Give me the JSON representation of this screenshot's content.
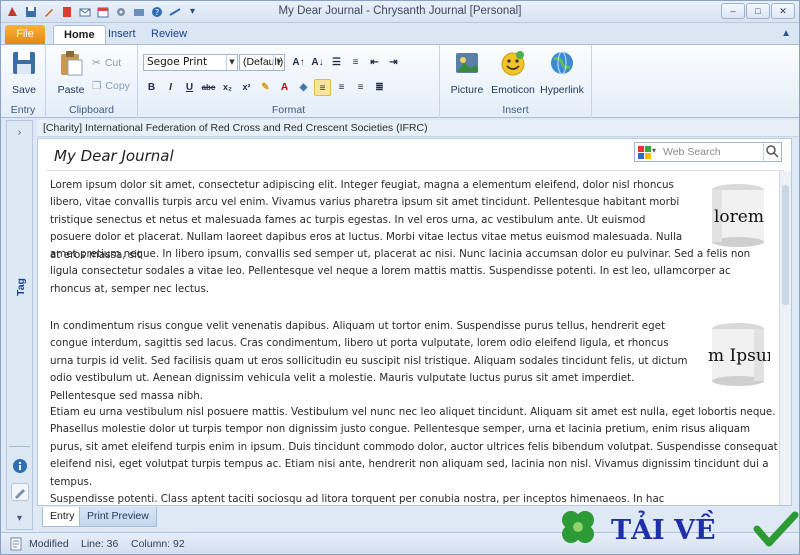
{
  "window": {
    "title": "My Dear Journal - Chrysanth Journal [Personal]"
  },
  "ribbon_tabs": {
    "file": "File",
    "home": "Home",
    "insert": "Insert",
    "review": "Review"
  },
  "entry_group": {
    "save": "Save",
    "label": "Entry"
  },
  "clipboard_group": {
    "paste": "Paste",
    "cut": "Cut",
    "copy": "Copy",
    "label": "Clipboard"
  },
  "format_group": {
    "font_name": "Segoe Print",
    "font_size": "(Default)",
    "label": "Format"
  },
  "insert_group": {
    "picture": "Picture",
    "emoticon": "Emoticon",
    "hyperlink": "Hyperlink",
    "label": "Insert"
  },
  "side_panel": {
    "tag_label": "Tag"
  },
  "document": {
    "category_header": "[Charity] International Federation of Red Cross and Red Crescent Societies (IFRC)",
    "title": "My Dear Journal",
    "search_placeholder": "Web Search",
    "para1_a": "Lorem ipsum dolor sit amet, consectetur adipiscing elit. Integer feugiat, magna a elementum eleifend, dolor nisl rhoncus libero, vitae convallis turpis arcu vel enim. Vivamus varius pharetra ipsum sit amet tincidunt. Pellentesque habitant morbi tristique senectus et netus et malesuada fames ac turpis egestas. In vel eros urna, ac vestibulum ante. Ut euismod posuere dolor et placerat. Nullam laoreet dapibus eros at luctus. Morbi vitae lectus vitae metus euismod malesuada. Nulla at eros massa, sit",
    "para1_b": "amet pretium neque. In libero ipsum, convallis sed semper ut, placerat ac nisi. Nunc lacinia accumsan dolor eu pulvinar. Sed a felis non ligula consectetur sodales a vitae leo. Pellentesque vel neque a lorem mattis mattis. Suspendisse potenti. In est leo, ullamcorper ac rhoncus at, semper nec lectus.",
    "para2_a": "In condimentum risus congue velit venenatis dapibus. Aliquam ut tortor enim. Suspendisse purus tellus, hendrerit eget congue interdum, sagittis sed lacus. Cras condimentum, libero ut porta vulputate, lorem odio eleifend ligula, et rhoncus urna turpis id velit. Sed facilisis quam ut eros sollicitudin eu suscipit nisl tristique. Aliquam sodales tincidunt felis, ut dictum odio vestibulum ut. Aenean dignissim vehicula velit a molestie. Mauris vulputate luctus purus sit amet imperdiet. Pellentesque sed massa nibh.",
    "para2_b": "Etiam eu urna vestibulum nisl posuere mattis. Vestibulum vel nunc nec leo aliquet tincidunt. Aliquam sit amet est nulla, eget lobortis neque. Phasellus molestie dolor ut turpis tempor non dignissim justo congue. Pellentesque semper, urna et lacinia pretium, enim risus aliquam purus, sit amet eleifend turpis enim in ipsum. Duis tincidunt commodo dolor, auctor ultrices felis bibendum volutpat. Suspendisse consequat eleifend nisi, eget volutpat turpis tempus ac. Etiam nisi ante, hendrerit non aliquam sed, lacinia non nisl. Vivamus dignissim tincidunt dui a tempus.",
    "para3": "Suspendisse potenti. Class aptent taciti sociosqu ad litora torquent per conubia nostra, per inceptos himenaeos. In hac habitasse",
    "mug1_text": "lorem Ip",
    "mug2_text": "m Ipsum"
  },
  "bottom_tabs": {
    "entry": "Entry",
    "print_preview": "Print Preview"
  },
  "status": {
    "state": "Modified",
    "line": "Line: 36",
    "column": "Column: 92"
  },
  "watermark": {
    "text": "TẢI VỀ"
  },
  "colors": {
    "file_tab": "#e48512",
    "ribbon_border": "#a7bcd6",
    "highlight": "#fbe39a",
    "watermark_green": "#2c9a35",
    "watermark_text": "#1e2fa8"
  }
}
